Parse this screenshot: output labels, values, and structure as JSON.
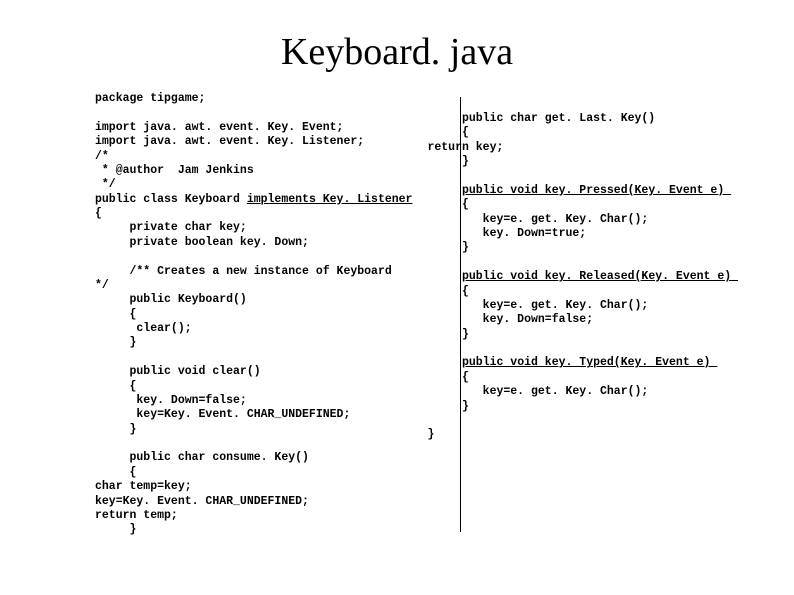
{
  "title": "Keyboard. java",
  "left": {
    "l1": "package tipgame;",
    "l2": "import java. awt. event. Key. Event;",
    "l3": "import java. awt. event. Key. Listener;",
    "l4": "/*",
    "l5": " * @author  Jam Jenkins",
    "l6": " */",
    "l7a": "public class Keyboard ",
    "l7b": "implements Key. Listener",
    "l8": "{",
    "l9": "     private char key;",
    "l10": "     private boolean key. Down;",
    "l11": "     /** Creates a new instance of Keyboard",
    "l12": "*/",
    "l13": "     public Keyboard()",
    "l14": "     {",
    "l15": "      clear();",
    "l16": "     }",
    "l17": "     public void clear()",
    "l18": "     {",
    "l19": "      key. Down=false;",
    "l20": "      key=Key. Event. CHAR_UNDEFINED;",
    "l21": "     }",
    "l22": "     public char consume. Key()",
    "l23": "     {",
    "l24": "char temp=key;",
    "l25": "key=Key. Event. CHAR_UNDEFINED;",
    "l26": "return temp;",
    "l27": "     }"
  },
  "right": {
    "r1": "     public char get. Last. Key()",
    "r2": "     {",
    "r3": "return key;",
    "r4": "     }",
    "r5a": "     ",
    "r5b": "public void key. Pressed(Key. Event e) ",
    "r6": "     {",
    "r7": "        key=e. get. Key. Char();",
    "r8": "        key. Down=true;",
    "r9": "     }",
    "r10a": "     ",
    "r10b": "public void key. Released(Key. Event e) ",
    "r11": "     {",
    "r12": "        key=e. get. Key. Char();",
    "r13": "        key. Down=false;",
    "r14": "     }",
    "r15a": "     ",
    "r15b": "public void key. Typed(Key. Event e) ",
    "r16": "     {",
    "r17": "        key=e. get. Key. Char();",
    "r18": "     }",
    "r19": "}"
  }
}
